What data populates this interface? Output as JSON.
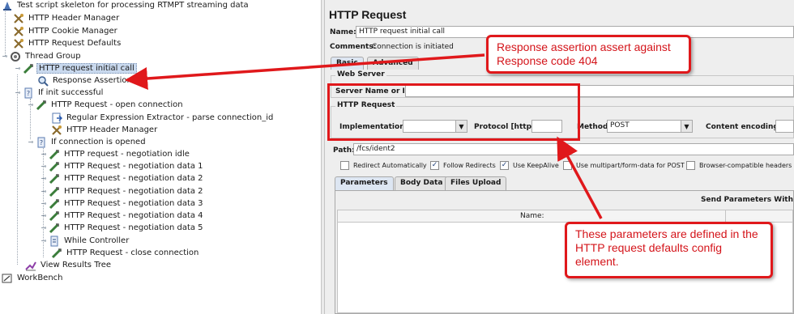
{
  "tree": {
    "items": [
      {
        "label": "Test script skeleton for processing RTMPT streaming data",
        "icon": "test-plan-icon"
      },
      {
        "label": "HTTP Header Manager",
        "icon": "config-element-icon"
      },
      {
        "label": "HTTP Cookie Manager",
        "icon": "config-element-icon"
      },
      {
        "label": "HTTP Request Defaults",
        "icon": "config-element-icon"
      },
      {
        "label": "Thread Group",
        "icon": "thread-group-icon"
      },
      {
        "label": "HTTP request initial call",
        "icon": "sampler-icon"
      },
      {
        "label": "Response Assertion",
        "icon": "assertion-icon"
      },
      {
        "label": "If init successful",
        "icon": "if-controller-icon"
      },
      {
        "label": "HTTP Request - open connection",
        "icon": "sampler-icon"
      },
      {
        "label": "Regular Expression Extractor - parse connection_id",
        "icon": "post-processor-icon"
      },
      {
        "label": "HTTP Header Manager",
        "icon": "config-element-icon"
      },
      {
        "label": "If connection is opened",
        "icon": "if-controller-icon"
      },
      {
        "label": "HTTP request - negotiation idle",
        "icon": "sampler-icon"
      },
      {
        "label": "HTTP Request - negotiation data 1",
        "icon": "sampler-icon"
      },
      {
        "label": "HTTP Request - negotiation data 2",
        "icon": "sampler-icon"
      },
      {
        "label": "HTTP Request - negotiation data 2",
        "icon": "sampler-icon"
      },
      {
        "label": "HTTP Request - negotiation data 3",
        "icon": "sampler-icon"
      },
      {
        "label": "HTTP Request - negotiation data 4",
        "icon": "sampler-icon"
      },
      {
        "label": "HTTP Request - negotiation data 5",
        "icon": "sampler-icon"
      },
      {
        "label": "While Controller",
        "icon": "while-controller-icon"
      },
      {
        "label": "HTTP Request - close connection",
        "icon": "sampler-icon"
      },
      {
        "label": "View Results Tree",
        "icon": "listener-icon"
      },
      {
        "label": "WorkBench",
        "icon": "workbench-icon"
      }
    ]
  },
  "panel": {
    "title": "HTTP Request",
    "name_label": "Name:",
    "name_value": "HTTP request initial call",
    "comments_label": "Comments:",
    "comments_value": "Connection is initiated",
    "top_tabs": [
      "Basic",
      "Advanced"
    ],
    "web_server_title": "Web Server",
    "server_label": "Server Name or IP:",
    "server_value": "",
    "http_request_title": "HTTP Request",
    "implementation_label": "Implementation:",
    "implementation_value": "",
    "protocol_label": "Protocol [http]:",
    "protocol_value": "",
    "method_label": "Method:",
    "method_value": "POST",
    "content_encoding_label": "Content encoding:",
    "content_encoding_value": "",
    "path_label": "Path:",
    "path_value": "/fcs/ident2",
    "checkboxes": [
      {
        "label": "Redirect Automatically",
        "checked": false
      },
      {
        "label": "Follow Redirects",
        "checked": true
      },
      {
        "label": "Use KeepAlive",
        "checked": true
      },
      {
        "label": "Use multipart/form-data for POST",
        "checked": false
      },
      {
        "label": "Browser-compatible headers",
        "checked": false
      }
    ],
    "param_tabs": [
      "Parameters",
      "Body Data",
      "Files Upload"
    ],
    "send_params_text": "Send Parameters With",
    "table_header_name": "Name:"
  },
  "annotations": {
    "callout_top": "Response assertion assert against Response code 404",
    "callout_bottom": "These parameters are defined in the HTTP request defaults config element.",
    "color": "#e0181b"
  }
}
